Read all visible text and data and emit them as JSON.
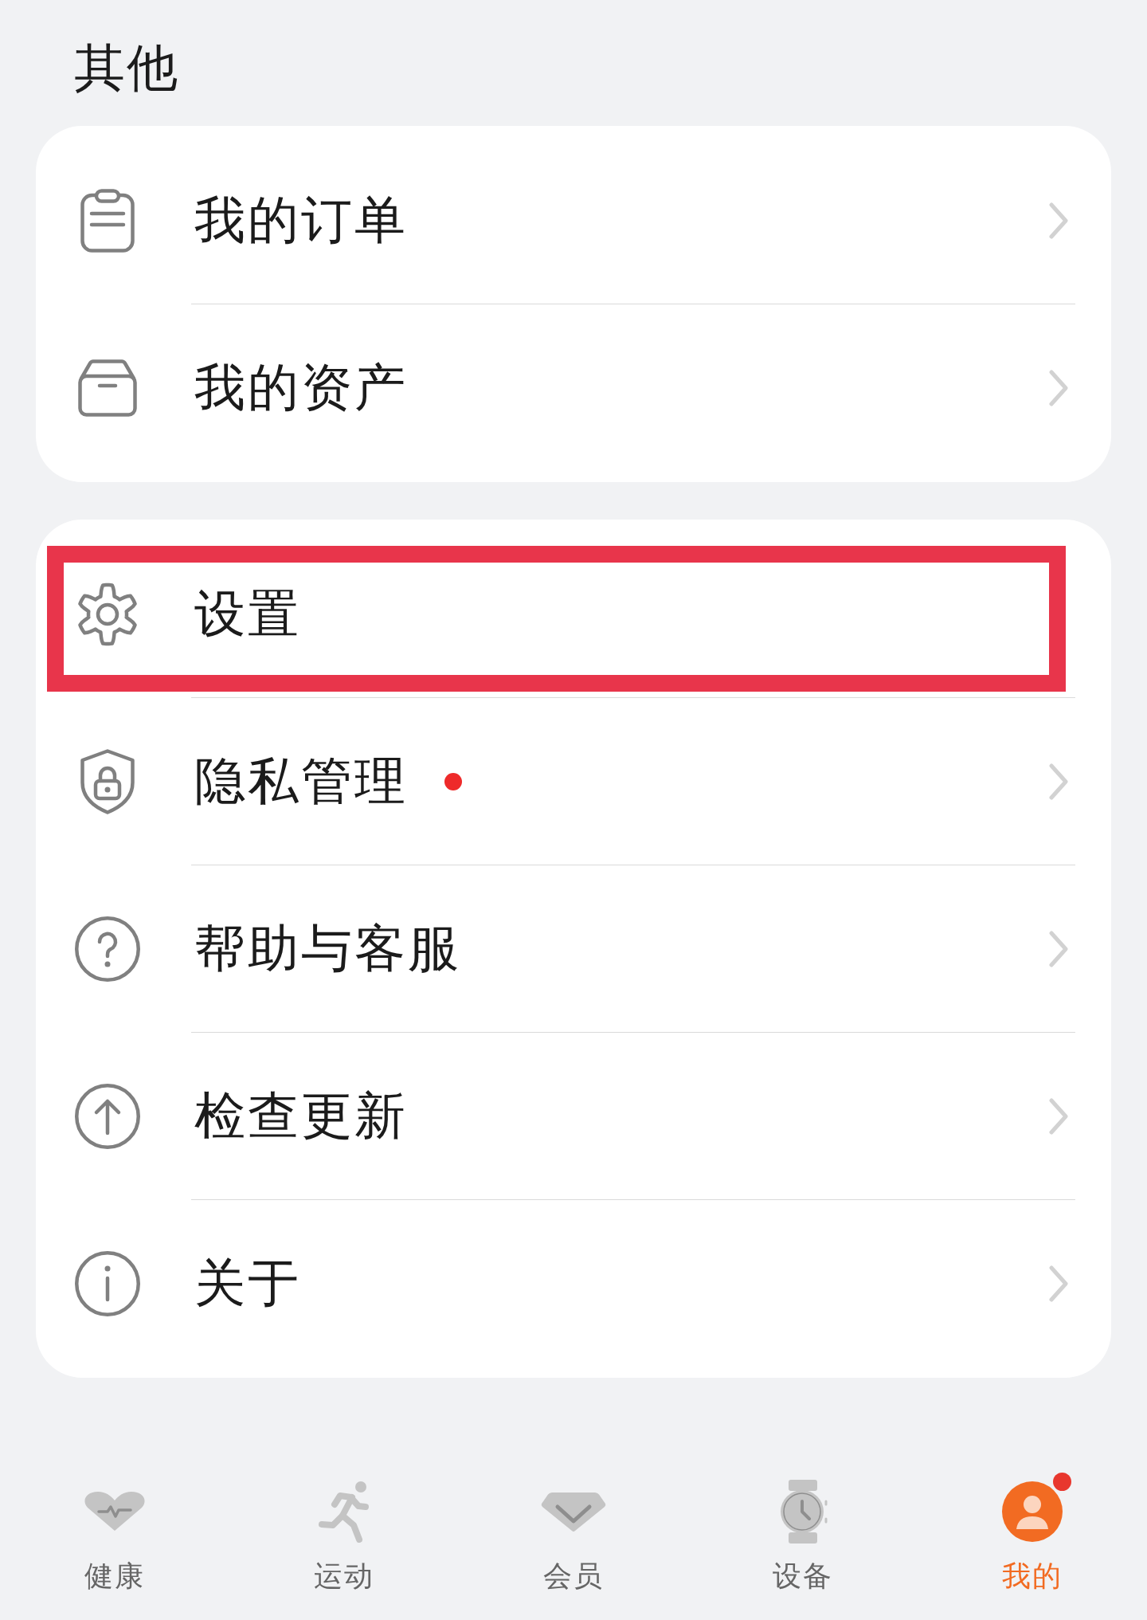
{
  "section_title": "其他",
  "cards": [
    {
      "items": [
        {
          "label": "我的订单",
          "dot": false,
          "highlighted": false
        },
        {
          "label": "我的资产",
          "dot": false,
          "highlighted": false
        }
      ]
    },
    {
      "items": [
        {
          "label": "设置",
          "dot": false,
          "highlighted": true
        },
        {
          "label": "隐私管理",
          "dot": true,
          "highlighted": false
        },
        {
          "label": "帮助与客服",
          "dot": false,
          "highlighted": false
        },
        {
          "label": "检查更新",
          "dot": false,
          "highlighted": false
        },
        {
          "label": "关于",
          "dot": false,
          "highlighted": false
        }
      ]
    }
  ],
  "tabs": [
    {
      "label": "健康",
      "selected": false,
      "dot": false
    },
    {
      "label": "运动",
      "selected": false,
      "dot": false
    },
    {
      "label": "会员",
      "selected": false,
      "dot": false
    },
    {
      "label": "设备",
      "selected": false,
      "dot": false
    },
    {
      "label": "我的",
      "selected": true,
      "dot": true
    }
  ]
}
